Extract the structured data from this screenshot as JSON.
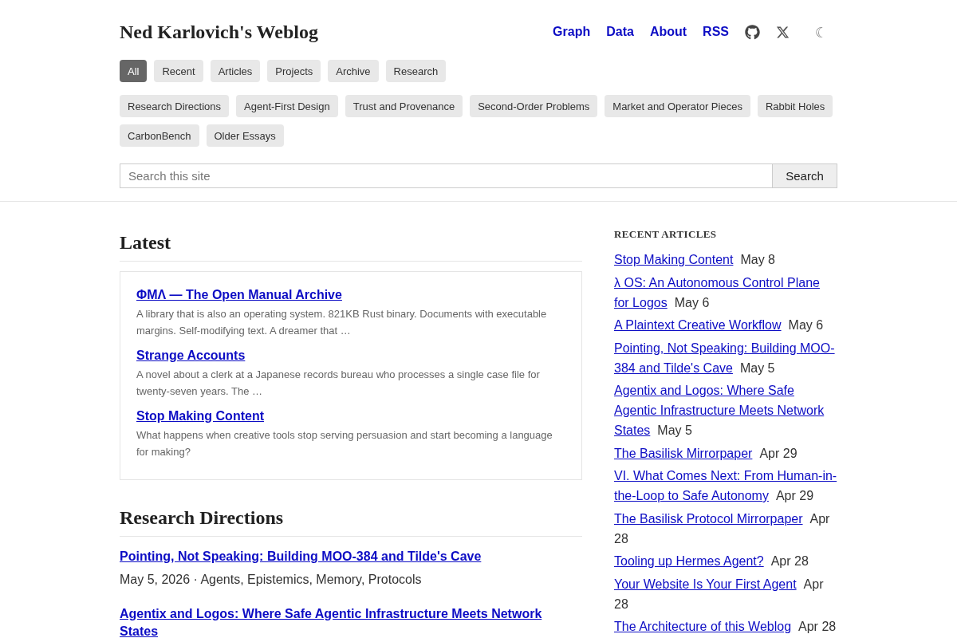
{
  "header": {
    "title": "Ned Karlovich's Weblog",
    "nav": [
      {
        "label": "Graph"
      },
      {
        "label": "Data"
      },
      {
        "label": "About"
      },
      {
        "label": "RSS"
      }
    ],
    "theme_toggle": "☾"
  },
  "filters": [
    {
      "label": "All",
      "selected": true
    },
    {
      "label": "Recent",
      "selected": false
    },
    {
      "label": "Articles",
      "selected": false
    },
    {
      "label": "Projects",
      "selected": false
    },
    {
      "label": "Archive",
      "selected": false
    },
    {
      "label": "Research",
      "selected": false
    }
  ],
  "topics": [
    {
      "label": "Research Directions"
    },
    {
      "label": "Agent-First Design"
    },
    {
      "label": "Trust and Provenance"
    },
    {
      "label": "Second-Order Problems"
    },
    {
      "label": "Market and Operator Pieces"
    },
    {
      "label": "Rabbit Holes"
    },
    {
      "label": "CarbonBench"
    },
    {
      "label": "Older Essays"
    }
  ],
  "search": {
    "placeholder": "Search this site",
    "button": "Search"
  },
  "latest": {
    "heading": "Latest",
    "items": [
      {
        "title": "ΦΜΛ — The Open Manual Archive",
        "excerpt": "A library that is also an operating system. 821KB Rust binary. Documents with executable margins. Self-modifying text. A dreamer that …"
      },
      {
        "title": "Strange Accounts",
        "excerpt": "A novel about a clerk at a Japanese records bureau who processes a single case file for twenty-seven years. The …"
      },
      {
        "title": "Stop Making Content",
        "excerpt": "What happens when creative tools stop serving persuasion and start becoming a language for making?"
      }
    ]
  },
  "sections": [
    {
      "heading": "Research Directions",
      "articles": [
        {
          "title": "Pointing, Not Speaking: Building MOO-384 and Tilde's Cave",
          "meta": "May 5, 2026 · Agents, Epistemics, Memory, Protocols"
        },
        {
          "title": "Agentix and Logos: Where Safe Agentic Infrastructure Meets Network States"
        }
      ]
    }
  ],
  "sidebar": {
    "heading": "RECENT ARTICLES",
    "articles": [
      {
        "title": "Stop Making Content",
        "date": "May 8"
      },
      {
        "title": "λ OS: An Autonomous Control Plane for Logos",
        "date": "May 6"
      },
      {
        "title": "A Plaintext Creative Workflow",
        "date": "May 6"
      },
      {
        "title": "Pointing, Not Speaking: Building MOO-384 and Tilde's Cave",
        "date": "May 5"
      },
      {
        "title": "Agentix and Logos: Where Safe Agentic Infrastructure Meets Network States",
        "date": "May 5"
      },
      {
        "title": "The Basilisk Mirrorpaper",
        "date": "Apr 29"
      },
      {
        "title": "VI. What Comes Next: From Human-in-the-Loop to Safe Autonomy",
        "date": "Apr 29"
      },
      {
        "title": "The Basilisk Protocol Mirrorpaper",
        "date": "Apr 28"
      },
      {
        "title": "Tooling up Hermes Agent?",
        "date": "Apr 28"
      },
      {
        "title": "Your Website Is Your First Agent",
        "date": "Apr 28"
      },
      {
        "title": "The Architecture of this Weblog",
        "date": "Apr 28"
      }
    ]
  }
}
